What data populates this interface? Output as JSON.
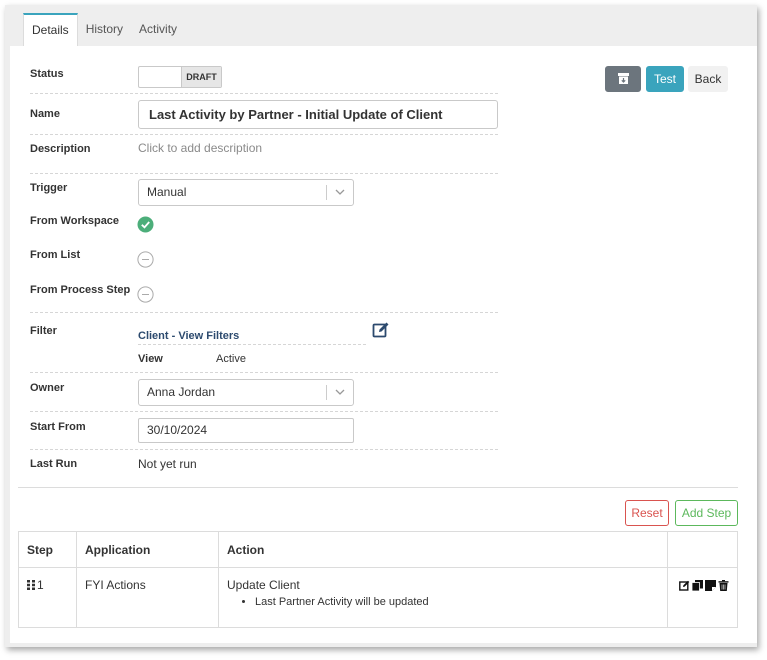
{
  "tabs": [
    {
      "label": "Details"
    },
    {
      "label": "History"
    },
    {
      "label": "Activity"
    }
  ],
  "fields": {
    "status": {
      "label": "Status",
      "value": "DRAFT"
    },
    "name": {
      "label": "Name",
      "value": "Last Activity by Partner - Initial Update of Client"
    },
    "description": {
      "label": "Description",
      "placeholder": "Click to add description"
    },
    "trigger": {
      "label": "Trigger",
      "value": "Manual"
    },
    "from_workspace": {
      "label": "From Workspace"
    },
    "from_list": {
      "label": "From List"
    },
    "from_process_step": {
      "label": "From Process Step"
    },
    "filter": {
      "label": "Filter",
      "link": "Client - View Filters",
      "view_label": "View",
      "view_value": "Active"
    },
    "owner": {
      "label": "Owner",
      "value": "Anna Jordan"
    },
    "start_from": {
      "label": "Start From",
      "value": "30/10/2024"
    },
    "last_run": {
      "label": "Last Run",
      "value": "Not yet run"
    }
  },
  "toolbar": {
    "test_label": "Test",
    "back_label": "Back"
  },
  "steps_toolbar": {
    "reset_label": "Reset",
    "add_step_label": "Add Step"
  },
  "steps_table": {
    "headers": [
      "Step",
      "Application",
      "Action",
      ""
    ],
    "rows": [
      {
        "step": "1",
        "application": "FYI Actions",
        "action": "Update Client",
        "detail": "Last Partner Activity will be updated"
      }
    ]
  },
  "colors": {
    "accent": "#3aa4bd",
    "success": "#4cae7a",
    "danger": "#d9534f",
    "add": "#5cb85c",
    "archive": "#6c757d"
  }
}
